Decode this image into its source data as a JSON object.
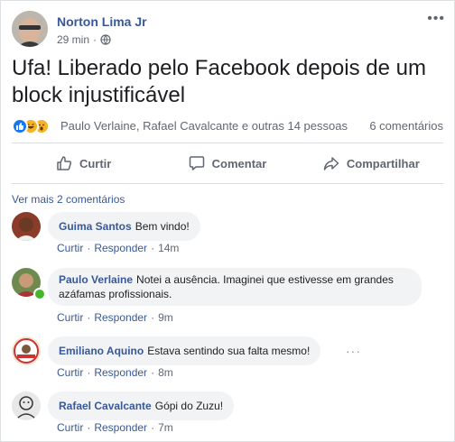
{
  "post": {
    "author": "Norton Lima Jr",
    "time": "29 min",
    "privacy_icon": "globe-icon",
    "more_icon": "ellipsis-icon",
    "text": "Ufa! Liberado pelo Facebook depois de um block injustificável"
  },
  "reactions": {
    "icons": [
      "like-icon",
      "haha-icon",
      "wow-icon"
    ],
    "names": "Paulo Verlaine, Rafael Cavalcante e outras 14 pessoas",
    "comment_count": "6 comentários"
  },
  "actions": {
    "like": "Curtir",
    "comment": "Comentar",
    "share": "Compartilhar"
  },
  "comments_header": {
    "more_comments": "Ver mais 2 comentários"
  },
  "comments": [
    {
      "name": "Guima Santos",
      "text": "Bem vindo!",
      "like": "Curtir",
      "reply": "Responder",
      "time": "14m"
    },
    {
      "name": "Paulo Verlaine",
      "text": "Notei a ausência. Imaginei que estivesse em grandes azáfamas profissionais.",
      "like": "Curtir",
      "reply": "Responder",
      "time": "9m"
    },
    {
      "name": "Emiliano Aquino",
      "text": "Estava sentindo sua falta mesmo!",
      "like": "Curtir",
      "reply": "Responder",
      "time": "8m"
    },
    {
      "name": "Rafael Cavalcante",
      "text": "Gópi do Zuzu!",
      "like": "Curtir",
      "reply": "Responder",
      "time": "7m"
    }
  ],
  "colors": {
    "link": "#385898",
    "accent": "#1877f2",
    "online": "#42b72a"
  }
}
